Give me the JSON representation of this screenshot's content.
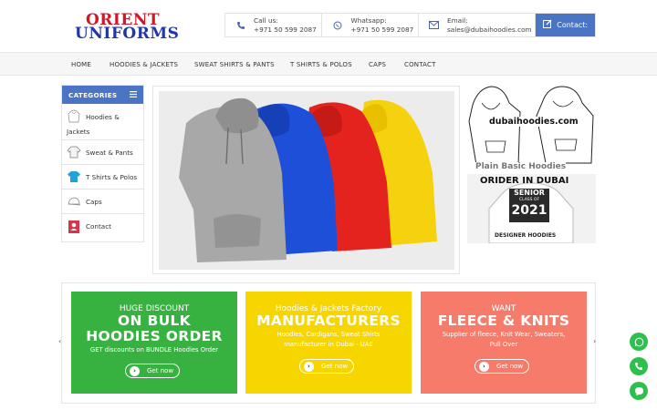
{
  "brand": {
    "line1": "ORIENT",
    "line2": "UNIFORMS"
  },
  "contacts": [
    {
      "label": "Call us:",
      "value": "+971 50 599 2087",
      "icon": "phone-icon"
    },
    {
      "label": "Whatsapp:",
      "value": "+971 50 599 2087",
      "icon": "whatsapp-icon"
    },
    {
      "label": "Email:",
      "value": "sales@dubaihoodies.com",
      "icon": "mail-icon"
    }
  ],
  "contact_button": "Contact:",
  "nav": [
    "HOME",
    "HOODIES & JACKETS",
    "SWEAT SHIRTS & PANTS",
    "T SHIRTS & POLOS",
    "CAPS",
    "CONTACT"
  ],
  "categories": {
    "title": "CATEGORIES",
    "items": [
      "Hoodies &",
      "Jackets",
      "Sweat & Pants",
      "T Shirts & Polos",
      "Caps",
      "Contact"
    ]
  },
  "side_ad": {
    "site": "dubaihoodies.com",
    "tagline": "Plain Basic Hoodies",
    "order": "ORIDER IN DUBAI",
    "print1": "SENIOR",
    "print2": "CLASS OF",
    "print3": "2021",
    "footer": "DESIGNER HOODIES"
  },
  "promos": [
    {
      "t1": "HUGE DISCOUNT",
      "t2a": "ON BULK",
      "t2b": "HOODIES ORDER",
      "t3a": "GET discounts on BUNDLE Hoodies Order",
      "t3b": "",
      "cta": "Get now",
      "bg": "#37b240"
    },
    {
      "t1": "Hoodies & Jackets Factory",
      "t2a": "MANUFACTURERS",
      "t2b": "",
      "t3a": "Hoodies, Cardigans, Sweat Shirts",
      "t3b": "manufacturer in Dubai - UAE",
      "cta": "Get now",
      "bg": "#f7d600"
    },
    {
      "t1": "WANT",
      "t2a": "FLEECE & KNITS",
      "t2b": "",
      "t3a": "Supplier of fleece, Knit Wear, Sweaters,",
      "t3b": "Pull Over",
      "cta": "Get now",
      "bg": "#f77b6b"
    }
  ],
  "colors": {
    "accent": "#4a74c4",
    "fab": "#2ec04f"
  }
}
